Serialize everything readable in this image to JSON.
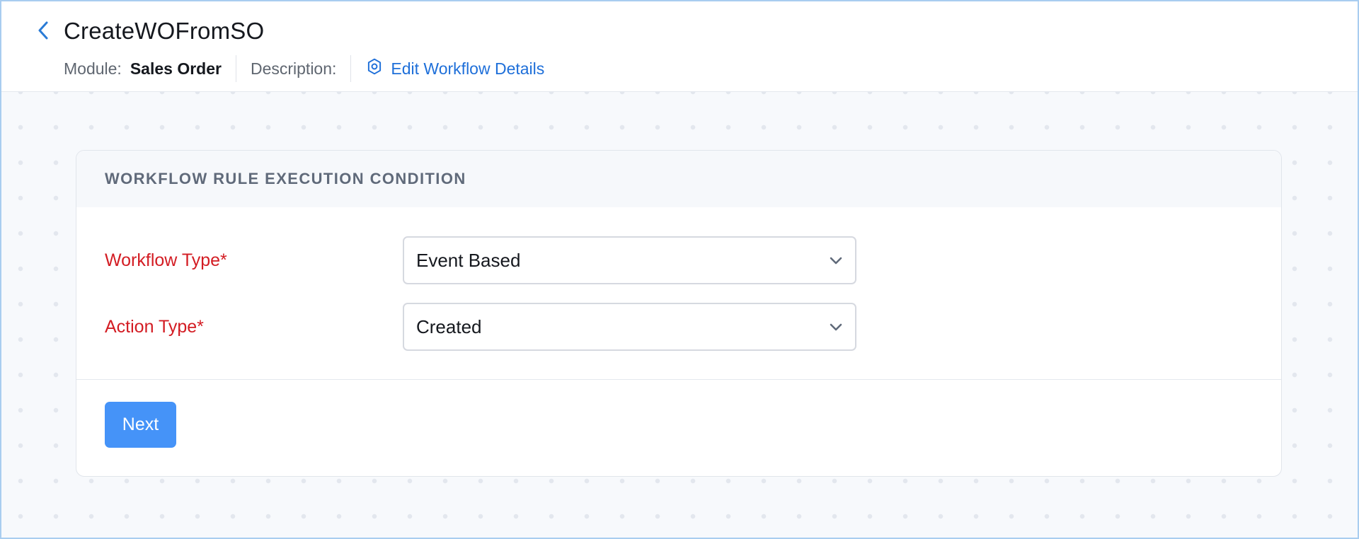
{
  "header": {
    "title": "CreateWOFromSO",
    "module_label": "Module:",
    "module_value": "Sales Order",
    "description_label": "Description:",
    "edit_link": "Edit Workflow Details"
  },
  "card": {
    "title": "WORKFLOW RULE EXECUTION CONDITION",
    "fields": [
      {
        "label": "Workflow Type*",
        "value": "Event Based"
      },
      {
        "label": "Action Type*",
        "value": "Created"
      }
    ],
    "next_label": "Next"
  },
  "colors": {
    "accent": "#1e6fd9",
    "button": "#4593f8",
    "required_label": "#d31c23"
  },
  "icons": {
    "back": "chevron-left-icon",
    "edit": "gear-icon",
    "select": "chevron-down-icon"
  }
}
